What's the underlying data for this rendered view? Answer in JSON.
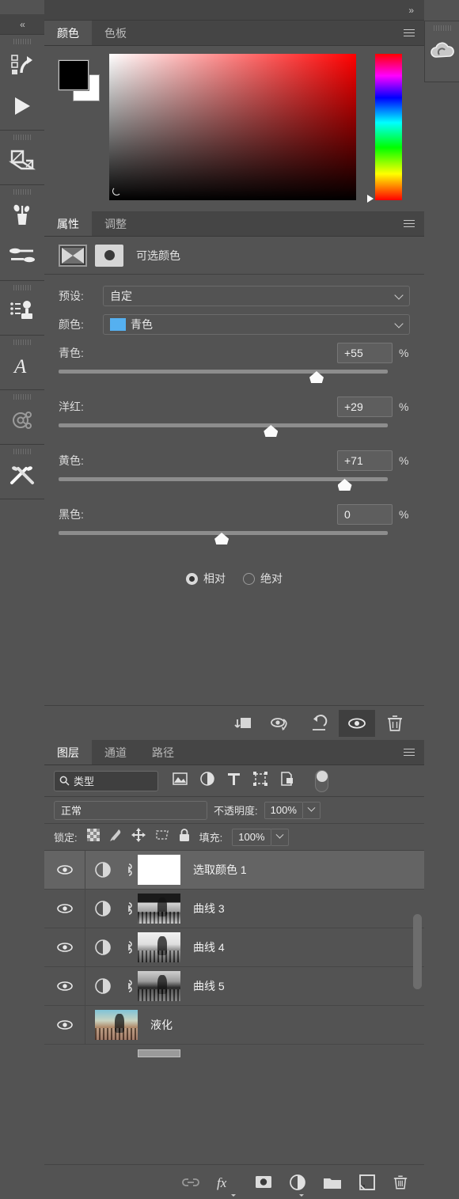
{
  "app": {
    "collapse_chevrons": "»",
    "accent_tab_active_bg": "#535353",
    "panel_bg": "#535353",
    "tabbar_bg": "#454545"
  },
  "left_rail": {
    "collapse_label": "«",
    "items": [
      {
        "icon": "actions-icon",
        "name": "actions-panel"
      },
      {
        "icon": "play-icon",
        "name": "play-action"
      },
      {
        "icon": "layer-comps-icon",
        "name": "layer-comps-panel"
      },
      {
        "icon": "brush-presets-icon",
        "name": "brush-presets-panel"
      },
      {
        "icon": "brush-settings-icon",
        "name": "brush-settings-panel"
      },
      {
        "icon": "clone-source-icon",
        "name": "clone-source-panel"
      },
      {
        "icon": "glyphs-icon",
        "name": "glyphs-panel"
      },
      {
        "icon": "three-d-icon",
        "name": "three-d-panel"
      },
      {
        "icon": "tool-presets-icon",
        "name": "tool-presets-panel"
      }
    ]
  },
  "color_panel": {
    "tabs": [
      {
        "label": "颜色",
        "active": true
      },
      {
        "label": "色板",
        "active": false
      }
    ],
    "foreground_color": "#000000",
    "background_color": "#ffffff",
    "spectrum_base": "#ff0000",
    "hue_stops": [
      "#ff0000",
      "#ff00ff",
      "#0000ff",
      "#00ffff",
      "#00ff00",
      "#ffff00",
      "#ff0000"
    ]
  },
  "properties_panel": {
    "tabs": [
      {
        "label": "属性",
        "active": true
      },
      {
        "label": "调整",
        "active": false
      }
    ],
    "adjustment_title": "可选颜色",
    "preset": {
      "label": "预设:",
      "value": "自定"
    },
    "color": {
      "label": "颜色:",
      "value": "青色",
      "chip": "#55b0f0"
    },
    "sliders": [
      {
        "label": "青色:",
        "value": "+55",
        "unit": "%",
        "pos_pct": 75
      },
      {
        "label": "洋红:",
        "value": "+29",
        "unit": "%",
        "pos_pct": 62
      },
      {
        "label": "黄色:",
        "value": "+71",
        "unit": "%",
        "pos_pct": 83
      },
      {
        "label": "黑色:",
        "value": "0",
        "unit": "%",
        "pos_pct": 48
      }
    ],
    "method": {
      "relative": {
        "label": "相对",
        "selected": true
      },
      "absolute": {
        "label": "绝对",
        "selected": false
      }
    },
    "footer_buttons": [
      {
        "name": "clip-to-layer-icon",
        "active": false
      },
      {
        "name": "view-previous-state-icon",
        "active": false
      },
      {
        "name": "reset-adjustment-icon",
        "active": false
      },
      {
        "name": "toggle-visibility-icon",
        "active": true
      },
      {
        "name": "delete-adjustment-icon",
        "active": false
      }
    ]
  },
  "layers_panel": {
    "tabs": [
      {
        "label": "图层",
        "active": true
      },
      {
        "label": "通道",
        "active": false
      },
      {
        "label": "路径",
        "active": false
      }
    ],
    "filter": {
      "value": "类型"
    },
    "filter_icons": [
      "filter-pixel-icon",
      "filter-adjustment-icon",
      "filter-type-icon",
      "filter-shape-icon",
      "filter-smart-object-icon"
    ],
    "filter_toggle": "filter-enable-toggle",
    "blend_mode": "正常",
    "opacity": {
      "label": "不透明度:",
      "value": "100%"
    },
    "lock": {
      "label": "锁定:"
    },
    "lock_icons": [
      "lock-transparent-pixels-icon",
      "lock-image-pixels-icon",
      "lock-position-icon",
      "lock-artboard-icon",
      "lock-all-icon"
    ],
    "fill": {
      "label": "填充:",
      "value": "100%"
    },
    "rows": [
      {
        "name": "选取颜色 1",
        "selected": true,
        "visible": true,
        "kind": "adjustment",
        "thumb": "white-mask",
        "linked": true
      },
      {
        "name": "曲线 3",
        "selected": false,
        "visible": true,
        "kind": "adjustment",
        "thumb": "bw1",
        "linked": true
      },
      {
        "name": "曲线 4",
        "selected": false,
        "visible": true,
        "kind": "adjustment",
        "thumb": "bw2",
        "linked": true
      },
      {
        "name": "曲线 5",
        "selected": false,
        "visible": true,
        "kind": "adjustment",
        "thumb": "bw3",
        "linked": true
      },
      {
        "name": "液化",
        "selected": false,
        "visible": true,
        "kind": "pixel",
        "thumb": "color",
        "linked": false
      }
    ],
    "footer_buttons": [
      "link-layers-icon",
      "layer-style-fx-icon",
      "add-layer-mask-icon",
      "new-adjustment-layer-icon",
      "new-group-icon",
      "new-layer-icon",
      "delete-layer-icon"
    ]
  },
  "right_rail": {
    "items": [
      {
        "icon": "creative-cloud-libraries-icon",
        "name": "libraries-panel"
      }
    ]
  }
}
